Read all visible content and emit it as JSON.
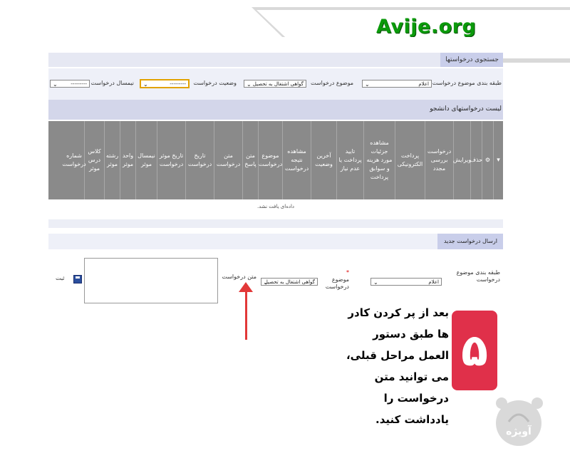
{
  "watermark": {
    "brand": "Avije.org",
    "logo_text": "آویژه"
  },
  "search_section": {
    "title": "جستجوی درخواستها"
  },
  "filters": {
    "category_label": "طبقه بندی موضوع درخواست",
    "category_value": "اعلام",
    "subject_label": "موضوع درخواست",
    "subject_value": "گواهی اشتغال به تحصیل",
    "status_label": "وضعیت درخواست",
    "status_value": "---------",
    "term_label": "نیمسال درخواست",
    "term_value": "---------"
  },
  "list_section": {
    "title": "لیست درخواستهای دانشجو"
  },
  "table": {
    "columns": [
      "حذف",
      "ویرایش",
      "درخواست بررسی مجدد",
      "پرداخت الکترونیکی",
      "مشاهده جزئیات مورد هزینه و سوابق پرداخت",
      "تایید پرداخت یا عدم نیاز",
      "آخرین وضعیت",
      "مشاهده نتیجه درخواست",
      "موضوع درخواست",
      "متن پاسخ",
      "متن درخواست",
      "تاریخ درخواست",
      "تاریخ موثر درخواست",
      "نیمسال موثر",
      "واحد موثر",
      "رشته موثر",
      "کلاس درس موثر",
      "شماره درخواست"
    ],
    "empty_message": "داده‌ای یافت نشد."
  },
  "new_request": {
    "title": "ارسال درخواست جدید",
    "category_label": "طبقه بندی موضوع درخواست",
    "category_value": "اعلام",
    "subject_label": "موضوع درخواست",
    "subject_required": "*",
    "subject_value": "گواهی اشتغال به تحصیل",
    "text_label": "متن درخواست",
    "save_label": "ثبت"
  },
  "annotation": {
    "step_number": "۵",
    "text": "بعد از پر کردن کادر ها طبق دستور العمل مراحل قبلی، می توانید متن درخواست را یادداشت کنید."
  },
  "colors": {
    "accent_red": "#e0304a",
    "header_blue": "#c9ceea",
    "grid_gray": "#8a8a8a",
    "brand_green": "#0b9a0b"
  }
}
